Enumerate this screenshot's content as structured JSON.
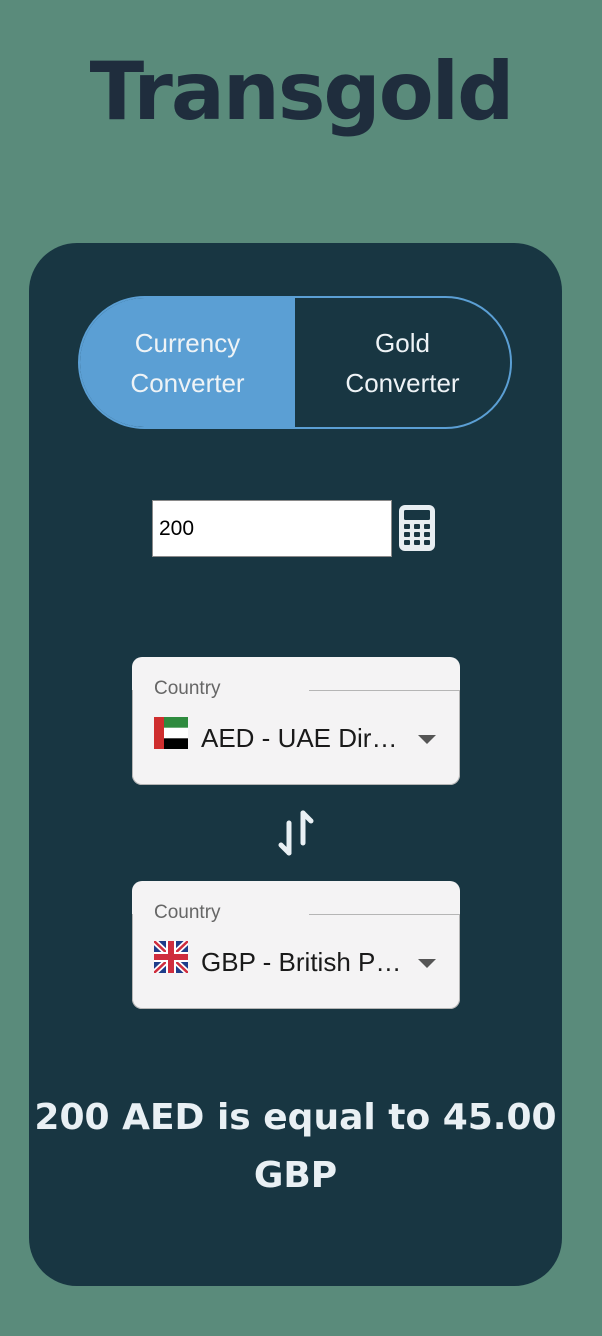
{
  "app": {
    "title": "Transgold"
  },
  "tabs": [
    {
      "label": "Currency\nConverter",
      "active": true
    },
    {
      "label": "Gold\nConverter",
      "active": false
    }
  ],
  "amount": {
    "value": "200",
    "icon": "calculator-icon"
  },
  "from_select": {
    "label": "Country",
    "value": "AED - UAE Dirham",
    "display": "AED - UAE Dir…",
    "flag_icon": "uae-flag-icon"
  },
  "swap": {
    "icon": "swap-arrows-icon"
  },
  "to_select": {
    "label": "Country",
    "value": "GBP - British Pound",
    "display": "GBP - British P…",
    "flag_icon": "uk-flag-icon"
  },
  "result": {
    "text": "200 AED is equal to 45.00 GBP"
  },
  "colors": {
    "background": "#5a8b7b",
    "card": "#183642",
    "accent": "#5b9fd4",
    "title": "#1f2d3d"
  }
}
